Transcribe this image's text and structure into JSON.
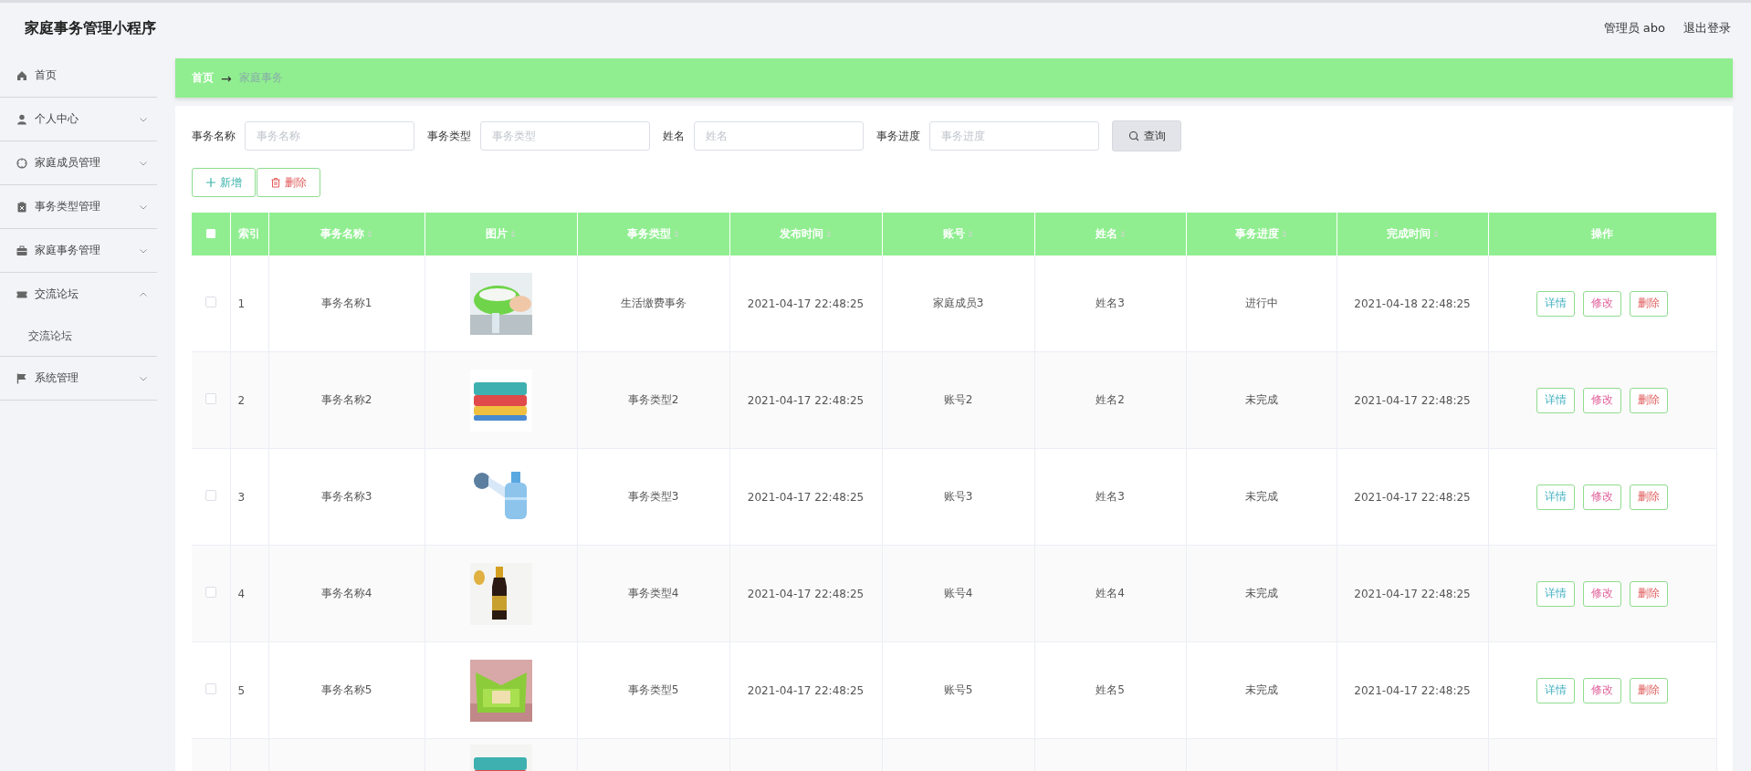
{
  "header": {
    "title": "家庭事务管理小程序",
    "user": "管理员 abo",
    "logout": "退出登录"
  },
  "sidebar": {
    "items": [
      {
        "label": "首页",
        "kind": "link"
      },
      {
        "label": "个人中心",
        "kind": "group",
        "expanded": false
      },
      {
        "label": "家庭成员管理",
        "kind": "group",
        "expanded": false
      },
      {
        "label": "事务类型管理",
        "kind": "group",
        "expanded": false
      },
      {
        "label": "家庭事务管理",
        "kind": "group",
        "expanded": false
      },
      {
        "label": "交流论坛",
        "kind": "group",
        "expanded": true,
        "children": [
          {
            "label": "交流论坛"
          }
        ]
      },
      {
        "label": "系统管理",
        "kind": "group",
        "expanded": false
      }
    ]
  },
  "breadcrumb": {
    "home": "首页",
    "arrow": "→",
    "current": "家庭事务"
  },
  "search": {
    "fields": [
      {
        "label": "事务名称",
        "placeholder": "事务名称"
      },
      {
        "label": "事务类型",
        "placeholder": "事务类型"
      },
      {
        "label": "姓名",
        "placeholder": "姓名"
      },
      {
        "label": "事务进度",
        "placeholder": "事务进度"
      }
    ],
    "button": "查询"
  },
  "toolbar": [
    {
      "label": "新增",
      "kind": "add"
    },
    {
      "label": "删除",
      "kind": "delete"
    }
  ],
  "table": {
    "select_all_checked": false,
    "columns": [
      {
        "label": "索引",
        "sortable": false
      },
      {
        "label": "事务名称",
        "sortable": true
      },
      {
        "label": "图片",
        "sortable": true
      },
      {
        "label": "事务类型",
        "sortable": true
      },
      {
        "label": "发布时间",
        "sortable": true
      },
      {
        "label": "账号",
        "sortable": true
      },
      {
        "label": "姓名",
        "sortable": true
      },
      {
        "label": "事务进度",
        "sortable": true
      },
      {
        "label": "完成时间",
        "sortable": true
      },
      {
        "label": "操作",
        "sortable": false
      }
    ],
    "rows": [
      {
        "checked": false,
        "cells": [
          "1",
          "事务名称1",
          {
            "kind": "picture"
          },
          "生活缴费事务",
          "2021-04-17 22:48:25",
          "家庭成员3",
          "姓名3",
          "进行中",
          "2021-04-18 22:48:25"
        ],
        "actions": [
          {
            "label": "详情",
            "kind": "detail"
          },
          {
            "label": "修改",
            "kind": "edit"
          },
          {
            "label": "删除",
            "kind": "delete"
          }
        ]
      },
      {
        "checked": false,
        "cells": [
          "2",
          "事务名称2",
          {
            "kind": "picture"
          },
          "事务类型2",
          "2021-04-17 22:48:25",
          "账号2",
          "姓名2",
          "未完成",
          "2021-04-17 22:48:25"
        ],
        "actions": [
          {
            "label": "详情",
            "kind": "detail"
          },
          {
            "label": "修改",
            "kind": "edit"
          },
          {
            "label": "删除",
            "kind": "delete"
          }
        ]
      },
      {
        "checked": false,
        "cells": [
          "3",
          "事务名称3",
          {
            "kind": "picture"
          },
          "事务类型3",
          "2021-04-17 22:48:25",
          "账号3",
          "姓名3",
          "未完成",
          "2021-04-17 22:48:25"
        ],
        "actions": [
          {
            "label": "详情",
            "kind": "detail"
          },
          {
            "label": "修改",
            "kind": "edit"
          },
          {
            "label": "删除",
            "kind": "delete"
          }
        ]
      },
      {
        "checked": false,
        "cells": [
          "4",
          "事务名称4",
          {
            "kind": "picture"
          },
          "事务类型4",
          "2021-04-17 22:48:25",
          "账号4",
          "姓名4",
          "未完成",
          "2021-04-17 22:48:25"
        ],
        "actions": [
          {
            "label": "详情",
            "kind": "detail"
          },
          {
            "label": "修改",
            "kind": "edit"
          },
          {
            "label": "删除",
            "kind": "delete"
          }
        ]
      },
      {
        "checked": false,
        "cells": [
          "5",
          "事务名称5",
          {
            "kind": "picture"
          },
          "事务类型5",
          "2021-04-17 22:48:25",
          "账号5",
          "姓名5",
          "未完成",
          "2021-04-17 22:48:25"
        ],
        "actions": [
          {
            "label": "详情",
            "kind": "detail"
          },
          {
            "label": "修改",
            "kind": "edit"
          },
          {
            "label": "删除",
            "kind": "delete"
          }
        ]
      },
      {
        "cells": [
          "",
          "",
          {
            "kind": "picture"
          }
        ]
      }
    ]
  }
}
